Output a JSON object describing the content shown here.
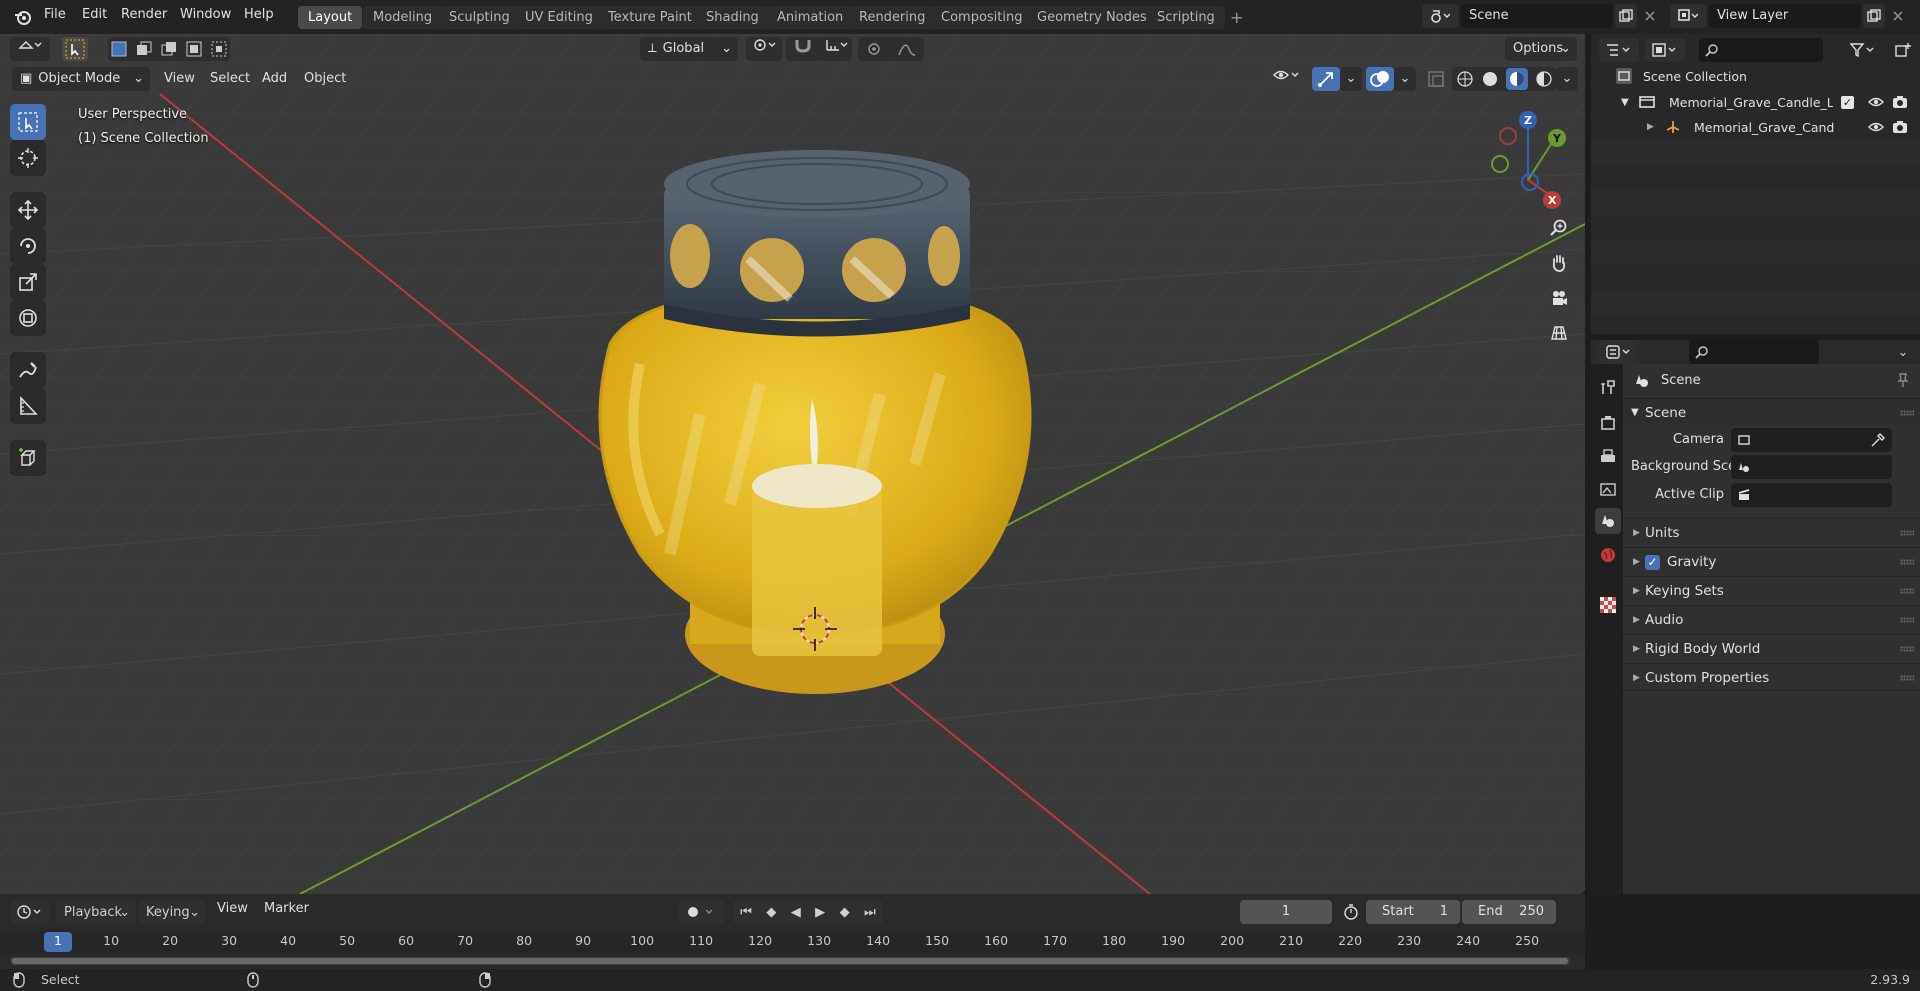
{
  "topbar": {
    "menus": [
      "File",
      "Edit",
      "Render",
      "Window",
      "Help"
    ],
    "workspaces": [
      "Layout",
      "Modeling",
      "Sculpting",
      "UV Editing",
      "Texture Paint",
      "Shading",
      "Animation",
      "Rendering",
      "Compositing",
      "Geometry Nodes",
      "Scripting"
    ],
    "active_workspace": "Layout",
    "add_tab": "+",
    "scene_name": "Scene",
    "view_layer": "View Layer"
  },
  "viewport": {
    "header": {
      "transform_orientation": "Global",
      "options_label": "Options",
      "mode": "Object Mode",
      "menus": [
        "View",
        "Select",
        "Add",
        "Object"
      ]
    },
    "overlay": {
      "perspective": "User Perspective",
      "collection": "(1) Scene Collection"
    },
    "gizmo": {
      "z": "Z",
      "y": "Y",
      "x": "X"
    },
    "colors": {
      "background": "#3a3a3a",
      "grid": "#4a4a4a",
      "x_axis": "#b93b3b",
      "y_axis": "#6c9a2e",
      "lamp_glass": "#e6b41e",
      "lamp_cap": "#3e4a57"
    }
  },
  "outliner": {
    "root": "Scene Collection",
    "items": [
      {
        "name": "Memorial_Grave_Candle_Lam",
        "type": "collection"
      },
      {
        "name": "Memorial_Grave_Candle_",
        "type": "object"
      }
    ]
  },
  "properties": {
    "context": "Scene",
    "panel_title": "Scene",
    "fields": [
      {
        "label": "Camera",
        "value": ""
      },
      {
        "label": "Background Scene",
        "value": ""
      },
      {
        "label": "Active Clip",
        "value": ""
      }
    ],
    "panels": [
      {
        "label": "Units",
        "checkbox": false
      },
      {
        "label": "Gravity",
        "checkbox": true,
        "checked": true
      },
      {
        "label": "Keying Sets",
        "checkbox": false
      },
      {
        "label": "Audio",
        "checkbox": false
      },
      {
        "label": "Rigid Body World",
        "checkbox": false
      },
      {
        "label": "Custom Properties",
        "checkbox": false
      }
    ]
  },
  "timeline": {
    "menus": [
      "Playback",
      "Keying",
      "View",
      "Marker"
    ],
    "current_frame": "1",
    "start_label": "Start",
    "start_value": "1",
    "end_label": "End",
    "end_value": "250",
    "ruler": [
      "1",
      "10",
      "20",
      "30",
      "40",
      "50",
      "60",
      "70",
      "80",
      "90",
      "100",
      "110",
      "120",
      "130",
      "140",
      "150",
      "160",
      "170",
      "180",
      "190",
      "200",
      "210",
      "220",
      "230",
      "240",
      "250"
    ]
  },
  "statusbar": {
    "left": "Select",
    "version": "2.93.9"
  }
}
